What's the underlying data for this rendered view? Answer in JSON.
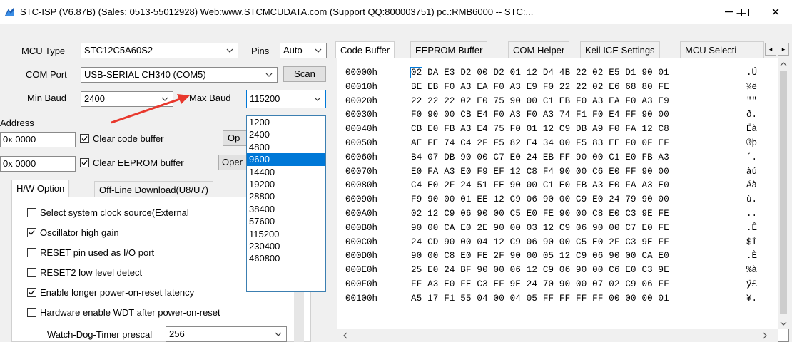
{
  "window": {
    "title": "STC-ISP (V6.87B) (Sales: 0513-55012928) Web:www.STCMCUDATA.com  (Support QQ:800003751) pc.:RMB6000 -- STC:...",
    "minimize": "—",
    "maximize": "☐",
    "close": "✕"
  },
  "left": {
    "mcu_type_label": "MCU Type",
    "mcu_type_value": "STC12C5A60S2",
    "pins_label": "Pins",
    "pins_value": "Auto",
    "com_port_label": "COM Port",
    "com_port_value": "USB-SERIAL CH340 (COM5)",
    "scan_label": "Scan",
    "min_baud_label": "Min Baud",
    "min_baud_value": "2400",
    "max_baud_label": "Max Baud",
    "max_baud_value": "115200",
    "address_label": "Address",
    "addr1": "0x 0000",
    "clear_code_label": "Clear code buffer",
    "open_btn1": "Op",
    "addr2": "0x 0000",
    "clear_eeprom_label": "Clear EEPROM buffer",
    "open_btn2": "Oper",
    "tab_hw": "H/W Option",
    "tab_offline": "Off-Line Download(U8/U7)",
    "options": [
      {
        "label": "Select system clock source(External",
        "checked": false
      },
      {
        "label": "Oscillator high gain",
        "checked": true
      },
      {
        "label": "RESET pin used as I/O port",
        "checked": false
      },
      {
        "label": "RESET2 low level detect",
        "checked": false
      },
      {
        "label": "Enable longer power-on-reset latency",
        "checked": true
      },
      {
        "label": "Hardware enable WDT after power-on-reset",
        "checked": false
      }
    ],
    "wdt_label": "Watch-Dog-Timer prescal",
    "wdt_value": "256"
  },
  "baud_options": [
    "1200",
    "2400",
    "4800",
    "9600",
    "14400",
    "19200",
    "28800",
    "38400",
    "57600",
    "115200",
    "230400",
    "460800"
  ],
  "baud_selected": "9600",
  "right": {
    "tabs": [
      "Code Buffer",
      "EEPROM Buffer",
      "COM Helper",
      "Keil ICE Settings",
      "MCU Selecti"
    ],
    "active_tab": "Code Buffer",
    "hex_rows": [
      {
        "addr": "00000h",
        "bytes": "02 DA E3 D2 00 D2 01 12 D4 4B 22 02 E5 D1 90 01",
        "ascii": ".Ú"
      },
      {
        "addr": "00010h",
        "bytes": "BE EB F0 A3 EA F0 A3 E9 F0 22 22 02 E6 68 80 FE",
        "ascii": "¾ë"
      },
      {
        "addr": "00020h",
        "bytes": "22 22 22 02 E0 75 90 00 C1 EB F0 A3 EA F0 A3 E9",
        "ascii": "\"\""
      },
      {
        "addr": "00030h",
        "bytes": "F0 90 00 CB E4 F0 A3 F0 A3 74 F1 F0 E4 FF 90 00",
        "ascii": "ð."
      },
      {
        "addr": "00040h",
        "bytes": "CB E0 FB A3 E4 75 F0 01 12 C9 DB A9 F0 FA 12 C8",
        "ascii": "Ëà"
      },
      {
        "addr": "00050h",
        "bytes": "AE FE 74 C4 2F F5 82 E4 34 00 F5 83 EE F0 0F EF",
        "ascii": "®þ"
      },
      {
        "addr": "00060h",
        "bytes": "B4 07 DB 90 00 C7 E0 24 EB FF 90 00 C1 E0 FB A3",
        "ascii": "´."
      },
      {
        "addr": "00070h",
        "bytes": "E0 FA A3 E0 F9 EF 12 C8 F4 90 00 C6 E0 FF 90 00",
        "ascii": "àú"
      },
      {
        "addr": "00080h",
        "bytes": "C4 E0 2F 24 51 FE 90 00 C1 E0 FB A3 E0 FA A3 E0",
        "ascii": "Äà"
      },
      {
        "addr": "00090h",
        "bytes": "F9 90 00 01 EE 12 C9 06 90 00 C9 E0 24 79 90 00",
        "ascii": "ù."
      },
      {
        "addr": "000A0h",
        "bytes": "02 12 C9 06 90 00 C5 E0 FE 90 00 C8 E0 C3 9E FE",
        "ascii": ".."
      },
      {
        "addr": "000B0h",
        "bytes": "90 00 CA E0 2E 90 00 03 12 C9 06 90 00 C7 E0 FE",
        "ascii": ".Ê"
      },
      {
        "addr": "000C0h",
        "bytes": "24 CD 90 00 04 12 C9 06 90 00 C5 E0 2F C3 9E FF",
        "ascii": "$Í"
      },
      {
        "addr": "000D0h",
        "bytes": "90 00 C8 E0 FE 2F 90 00 05 12 C9 06 90 00 CA E0",
        "ascii": ".È"
      },
      {
        "addr": "000E0h",
        "bytes": "25 E0 24 BF 90 00 06 12 C9 06 90 00 C6 E0 C3 9E",
        "ascii": "%à"
      },
      {
        "addr": "000F0h",
        "bytes": "FF A3 E0 FE C3 EF 9E 24 70 90 00 07 02 C9 06 FF",
        "ascii": "ÿ£"
      },
      {
        "addr": "00100h",
        "bytes": "A5 17 F1 55 04 00 04 05 FF FF FF FF 00 00 00 01",
        "ascii": "¥."
      }
    ]
  },
  "colors": {
    "accent": "#0078d7",
    "arrow": "#e8382d"
  }
}
